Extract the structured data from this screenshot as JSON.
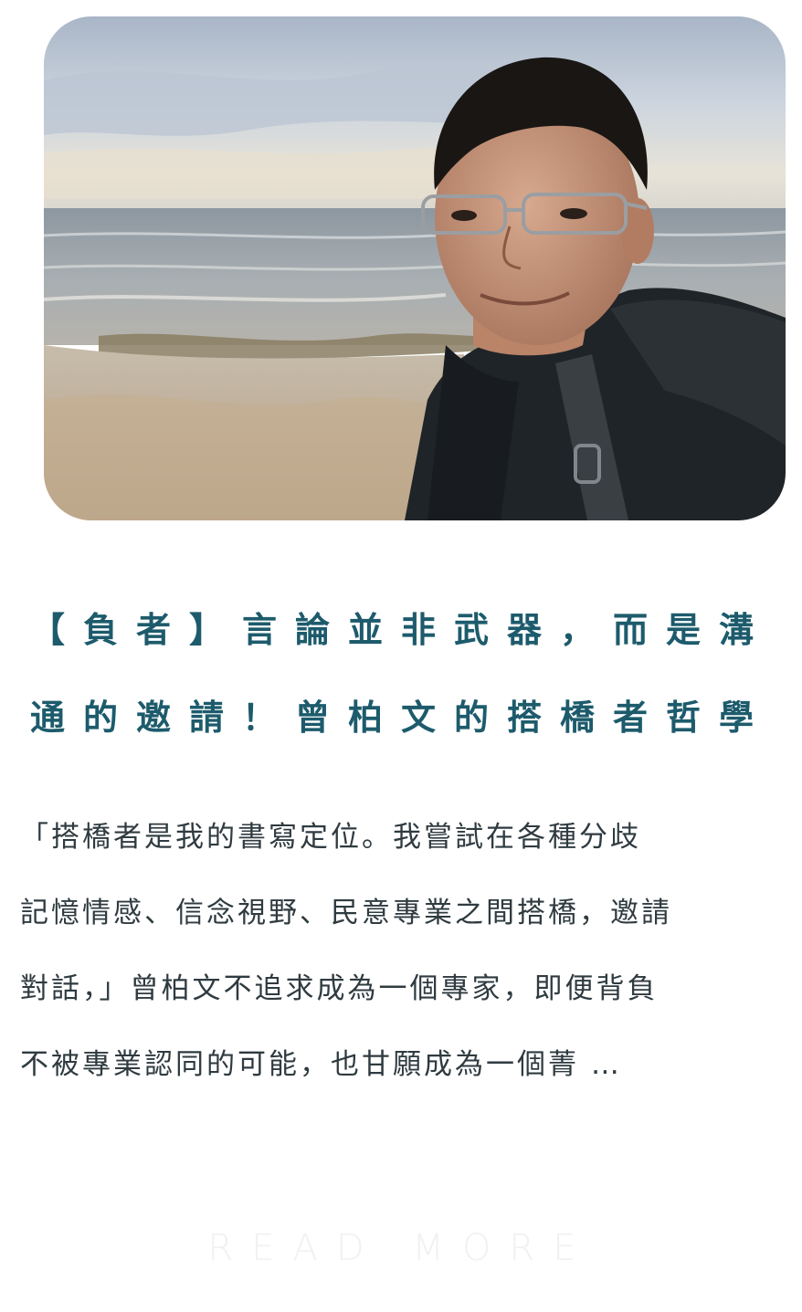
{
  "article": {
    "headline_lines": [
      "【負者】言論並非武器，而是溝",
      "通的邀請！曾柏文的搭橋者哲學"
    ],
    "excerpt_lines": [
      "「搭橋者是我的書寫定位。我嘗試在各種分歧",
      "記憶情感、信念視野、民意專業之間搭橋，邀請",
      "對話，」曾柏文不追求成為一個專家，即便背負",
      "不被專業認同的可能，也甘願成為一個菁 …"
    ],
    "read_more_label": "READ MORE"
  },
  "colors": {
    "headline": "#1d5b6c",
    "excerpt": "#2f3b40",
    "read_more": "#f1f1f1"
  }
}
